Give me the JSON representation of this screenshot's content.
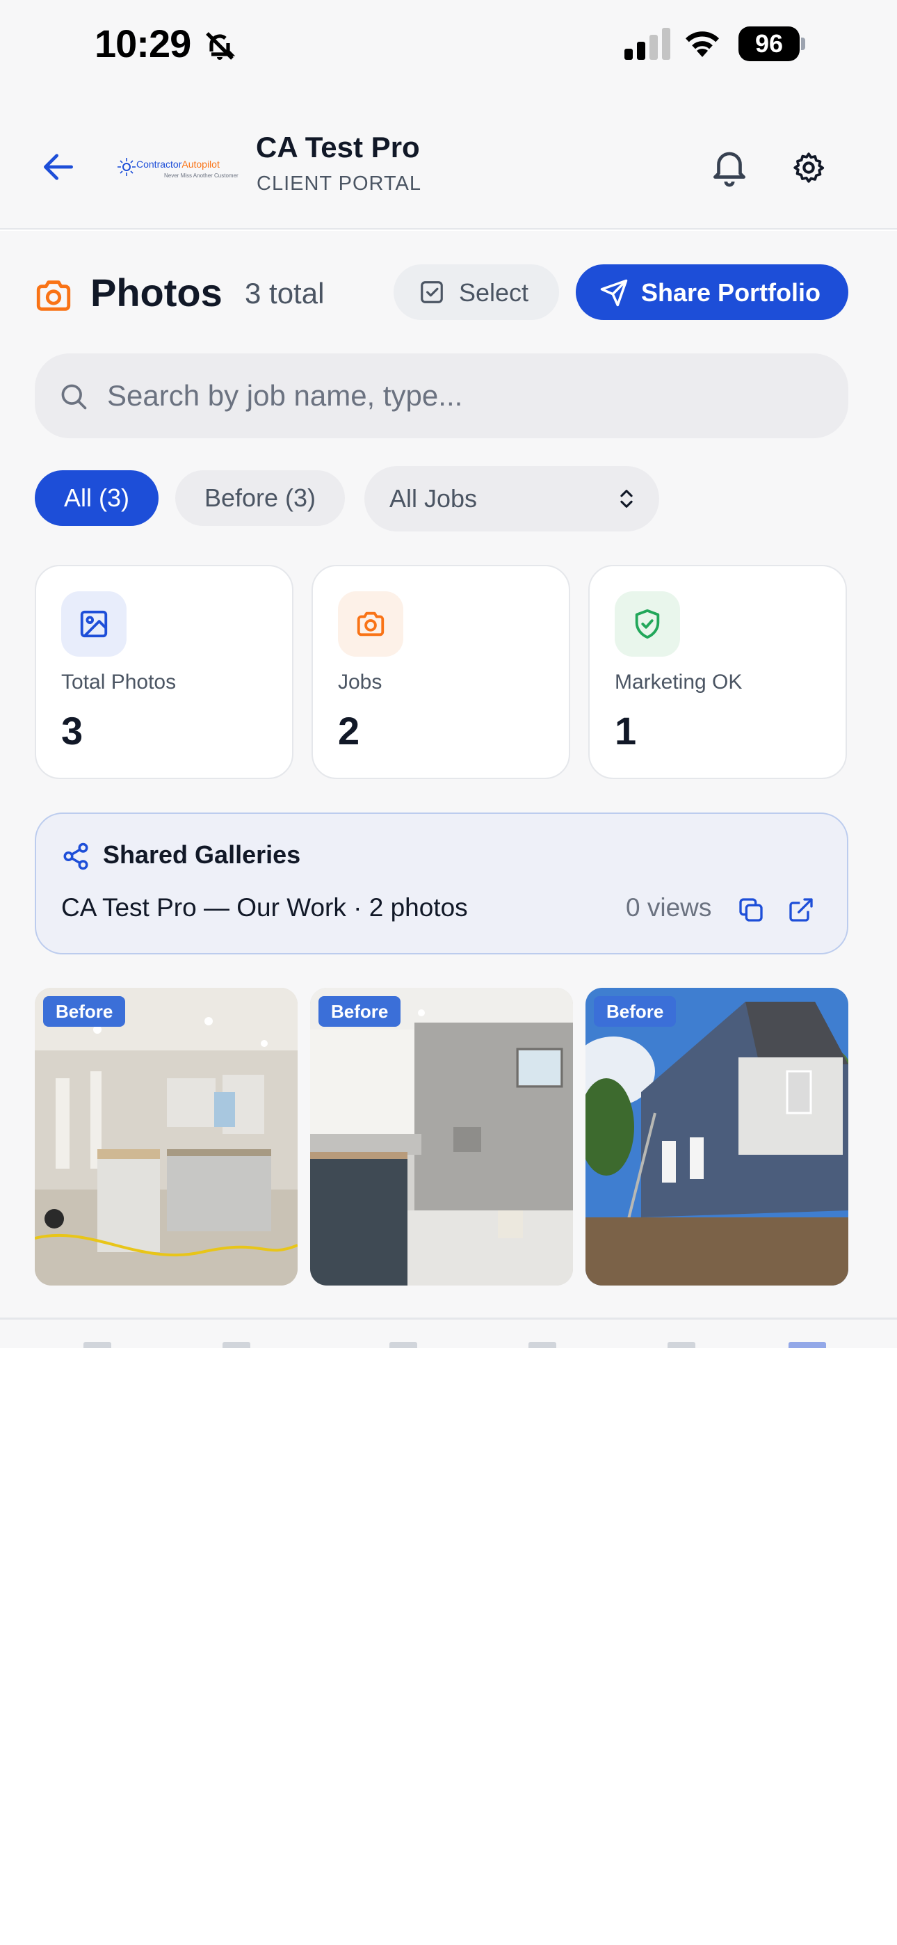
{
  "status_bar": {
    "time": "10:29",
    "battery": "96"
  },
  "header": {
    "title": "CA Test Pro",
    "subtitle": "CLIENT PORTAL",
    "logo": {
      "brand_a": "Contractor",
      "brand_b": "Autopilot",
      "tagline": "Never Miss Another Customer"
    }
  },
  "page": {
    "title": "Photos",
    "count": "3 total",
    "icon": "camera-icon"
  },
  "actions": {
    "select_label": "Select",
    "share_label": "Share Portfolio"
  },
  "search": {
    "placeholder": "Search by job name, type...",
    "value": ""
  },
  "filters": {
    "all_label": "All (3)",
    "before_label": "Before (3)",
    "jobs_selected": "All Jobs"
  },
  "stats": [
    {
      "label": "Total Photos",
      "value": "3",
      "icon": "image-icon",
      "color": "#1d4ed8",
      "bg": "#e8edfb"
    },
    {
      "label": "Jobs",
      "value": "2",
      "icon": "camera-icon",
      "color": "#f97316",
      "bg": "#fdf1e8"
    },
    {
      "label": "Marketing OK",
      "value": "1",
      "icon": "shield-check-icon",
      "color": "#22a75a",
      "bg": "#e9f6ec"
    }
  ],
  "shared_galleries": {
    "title": "Shared Galleries",
    "name": "CA Test Pro — Our Work · 2 photos",
    "views": "0 views"
  },
  "photos": [
    {
      "tag": "Before",
      "subject": "kitchen-remodel"
    },
    {
      "tag": "Before",
      "subject": "bathroom-remodel"
    },
    {
      "tag": "Before",
      "subject": "house-exterior"
    }
  ],
  "colors": {
    "accent": "#1d4ed8",
    "brand_orange": "#f97316",
    "success": "#22a75a",
    "tag": "#3b6fd8"
  }
}
